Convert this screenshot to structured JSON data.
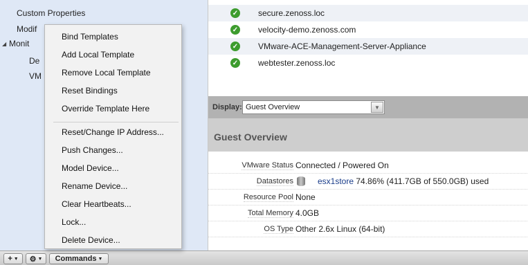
{
  "tree": {
    "items": [
      {
        "label": "Custom Properties"
      },
      {
        "label": "Modif"
      },
      {
        "label": "Monit"
      },
      {
        "label": "De"
      },
      {
        "label": "VM"
      }
    ]
  },
  "menu": {
    "items": [
      "Bind Templates",
      "Add Local Template",
      "Remove Local Template",
      "Reset Bindings",
      "Override Template Here",
      "Reset/Change IP Address...",
      "Push Changes...",
      "Model Device...",
      "Rename Device...",
      "Clear Heartbeats...",
      "Lock...",
      "Delete Device..."
    ]
  },
  "toolbar": {
    "add_label": "+",
    "gear_label": "⚙",
    "commands_label": "Commands"
  },
  "devices": [
    "secure.zenoss.loc",
    "velocity-demo.zenoss.com",
    "VMware-ACE-Management-Server-Appliance",
    "webtester.zenoss.loc"
  ],
  "display": {
    "label": "Display:",
    "selected": "Guest Overview"
  },
  "overview": {
    "title": "Guest Overview",
    "properties": [
      {
        "label": "VMware Status",
        "value": "Connected / Powered On"
      },
      {
        "label": "Datastores",
        "link": "esx1store",
        "value": "74.86% (411.7GB of 550.0GB) used"
      },
      {
        "label": "Resource Pool",
        "value": "None"
      },
      {
        "label": "Total Memory",
        "value": "4.0GB"
      },
      {
        "label": "OS Type",
        "value": "Other 2.6x Linux (64-bit)"
      }
    ]
  },
  "colors": {
    "status_ok": "#3d9c2e",
    "tree_bg": "#dfe8f6",
    "link": "#1a3d8a"
  }
}
